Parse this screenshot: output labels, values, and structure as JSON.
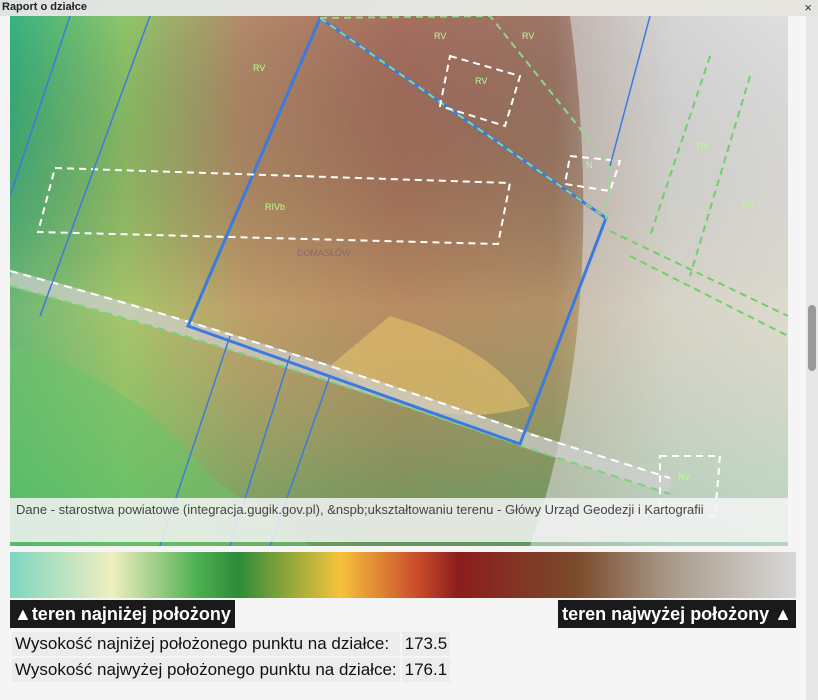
{
  "window": {
    "title": "Raport o działce",
    "close_icon": "×"
  },
  "map": {
    "attribution": "Dane - starostwa powiatowe (integracja.gugik.gov.pl), &nspb;ukształtowaniu terenu - Główy Urząd Geodezji i Kartografii",
    "place_label": "DOMASŁÓW",
    "parcel_labels": [
      "RV",
      "RV",
      "RV",
      "RIVb",
      "RV",
      "RV",
      "RV",
      "N",
      "RV"
    ],
    "colors": {
      "parcel_outline": "#3b7be0",
      "boundary_dashed": "#6fcf6a"
    }
  },
  "legend": {
    "low_label": "▲teren najniżej położony",
    "high_label": "teren najwyżej położony ▲",
    "colors": [
      "#7fd6c0",
      "#f0eec0",
      "#4caf50",
      "#2e8b3a",
      "#f5c33b",
      "#c84a2a",
      "#8b1e1e",
      "#7a4a2a",
      "#a89a8a",
      "#d8d8d8"
    ]
  },
  "elevation": {
    "rows": [
      {
        "label": "Wysokość najniżej położonego punktu na działce:",
        "value": "173.5"
      },
      {
        "label": "Wysokość najwyżej położonego punktu na działce:",
        "value": "176.1"
      }
    ]
  }
}
